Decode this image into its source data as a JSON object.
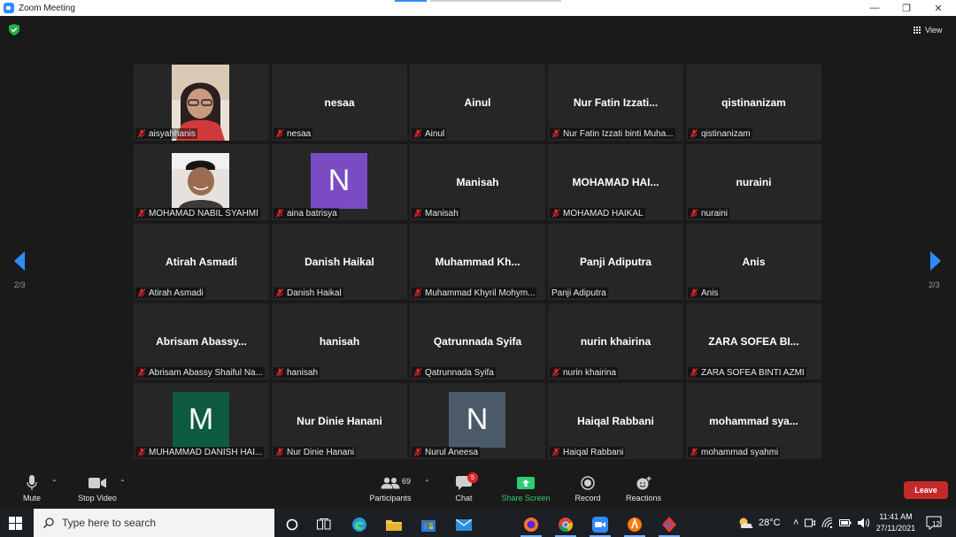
{
  "window": {
    "title": "Zoom Meeting",
    "minimize": "—",
    "restore": "❐",
    "close": "✕"
  },
  "view_button": {
    "label": "View"
  },
  "navigation": {
    "page_indicator": "2/3"
  },
  "participants": [
    {
      "center_name": "",
      "label": "aisyahhanis",
      "avatar": "photo-woman"
    },
    {
      "center_name": "nesaa",
      "label": "nesaa"
    },
    {
      "center_name": "Ainul",
      "label": "Ainul"
    },
    {
      "center_name": "Nur Fatin Izzati...",
      "label": "Nur Fatin Izzati binti Muha..."
    },
    {
      "center_name": "qistinanizam",
      "label": "qistinanizam"
    },
    {
      "center_name": "",
      "label": "MOHAMAD NABIL SYAHMI",
      "avatar": "photo-man"
    },
    {
      "center_name": "",
      "label": "aina batrisya",
      "avatar_letter": "N",
      "avatar_color": "#7b4bc4"
    },
    {
      "center_name": "Manisah",
      "label": "Manisah"
    },
    {
      "center_name": "MOHAMAD HAI...",
      "label": "MOHAMAD HAIKAL"
    },
    {
      "center_name": "nuraini",
      "label": "nuraini"
    },
    {
      "center_name": "Atirah Asmadi",
      "label": "Atirah Asmadi"
    },
    {
      "center_name": "Danish Haikal",
      "label": "Danish Haikal"
    },
    {
      "center_name": "Muhammad Kh...",
      "label": "Muhammad Khyril Mohym..."
    },
    {
      "center_name": "Panji Adiputra",
      "label": "Panji Adiputra",
      "unmuted": true
    },
    {
      "center_name": "Anis",
      "label": "Anis"
    },
    {
      "center_name": "Abrisam Abassy...",
      "label": "Abrisam Abassy Shaiful Na..."
    },
    {
      "center_name": "hanisah",
      "label": "hanisah"
    },
    {
      "center_name": "Qatrunnada Syifa",
      "label": "Qatrunnada Syifa"
    },
    {
      "center_name": "nurin khairina",
      "label": "nurin khairina"
    },
    {
      "center_name": "ZARA SOFEA BI...",
      "label": "ZARA SOFEA BINTI AZMI"
    },
    {
      "center_name": "",
      "label": "MUHAMMAD DANISH HAI...",
      "avatar_letter": "M",
      "avatar_color": "#0f5a43"
    },
    {
      "center_name": "Nur Dinie Hanani",
      "label": "Nur Dinie Hanani"
    },
    {
      "center_name": "",
      "label": "Nurul Aneesa",
      "avatar_letter": "N",
      "avatar_color": "#4a5a68"
    },
    {
      "center_name": "Haiqal Rabbani",
      "label": "Haiqal Rabbani"
    },
    {
      "center_name": "mohammad sya...",
      "label": "mohammad syahmi"
    }
  ],
  "toolbar": {
    "mute": "Mute",
    "stop_video": "Stop Video",
    "participants": "Participants",
    "participants_count": "69",
    "chat": "Chat",
    "chat_badge": "5",
    "share_screen": "Share Screen",
    "record": "Record",
    "reactions": "Reactions",
    "leave": "Leave"
  },
  "taskbar": {
    "search_placeholder": "Type here to search",
    "temperature": "28°C",
    "time": "11:41 AM",
    "date": "27/11/2021",
    "notifications": "12"
  },
  "colors": {
    "accent": "#2d8cff",
    "share_green": "#2fcc71",
    "leave_red": "#c52a2a",
    "muted_red": "#e02828"
  }
}
